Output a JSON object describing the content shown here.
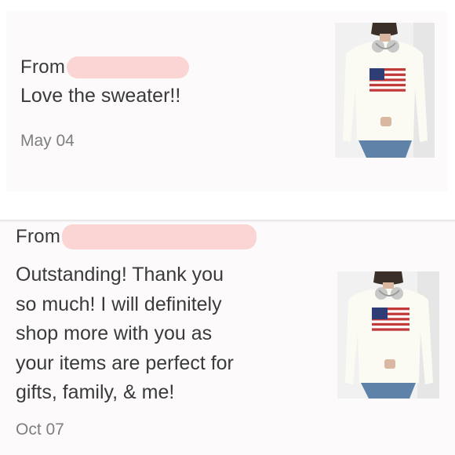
{
  "reviews": [
    {
      "from_label": "From",
      "message_lines": [
        "Love the sweater!!"
      ],
      "date": "May 04",
      "product_image": "american-flag-sweater"
    },
    {
      "from_label": "From",
      "message_lines": [
        "Outstanding! Thank you",
        "so much! I will definitely",
        "shop more with you as",
        "your items are perfect for",
        "gifts, family, & me!"
      ],
      "date": "Oct 07",
      "product_image": "american-flag-sweater"
    }
  ],
  "colors": {
    "card_background": "#fcfafb",
    "redaction": "#fbd4d4",
    "text": "#3a3a3a",
    "date_text": "#7f7f7f"
  }
}
